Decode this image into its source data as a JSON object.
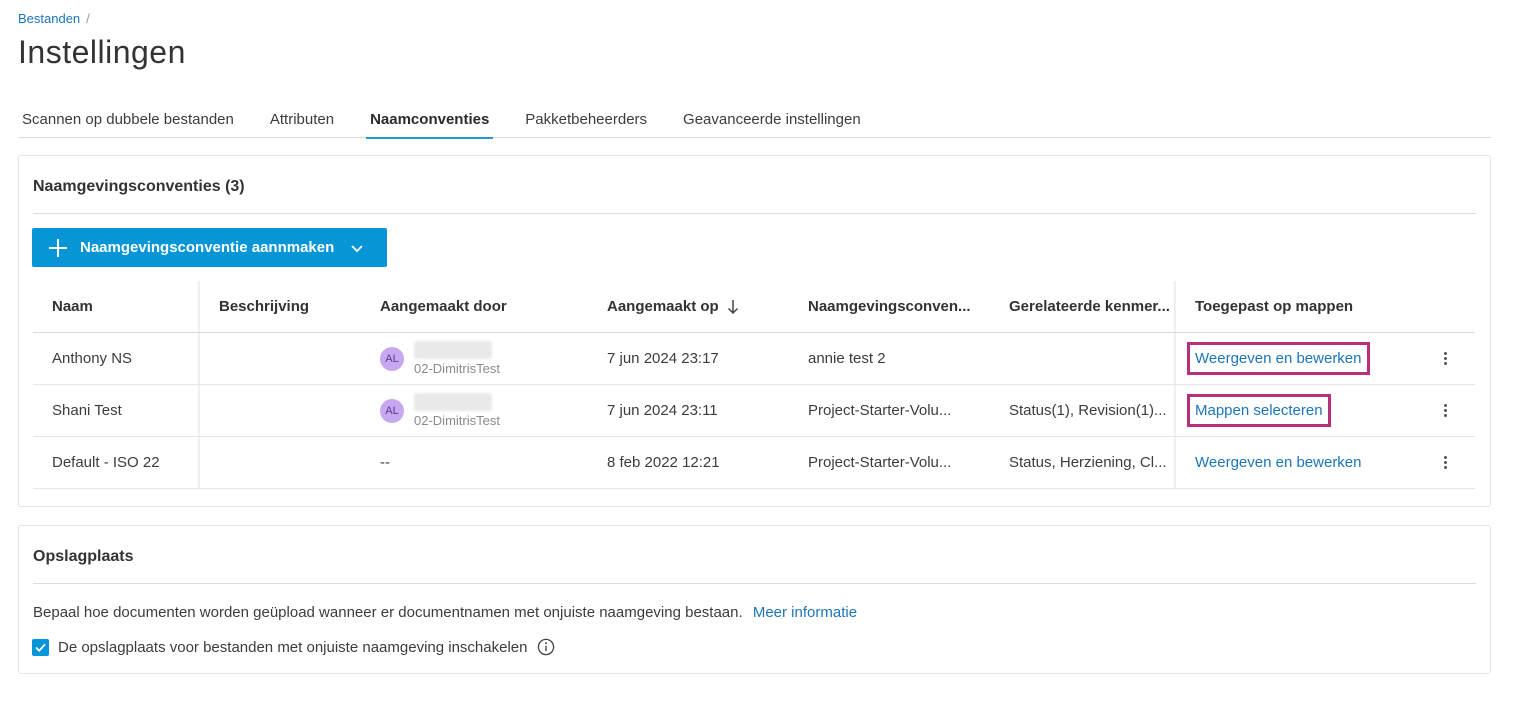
{
  "breadcrumb": {
    "parent": "Bestanden",
    "separator": "/"
  },
  "page_title": "Instellingen",
  "tabs": [
    {
      "label": "Scannen op dubbele bestanden",
      "active": false
    },
    {
      "label": "Attributen",
      "active": false
    },
    {
      "label": "Naamconventies",
      "active": true
    },
    {
      "label": "Pakketbeheerders",
      "active": false
    },
    {
      "label": "Geavanceerde instellingen",
      "active": false
    }
  ],
  "conventions_card": {
    "title": "Naamgevingsconventies (3)",
    "create_button_label": "Naamgevingsconventie aannmaken",
    "columns": {
      "name": "Naam",
      "description": "Beschrijving",
      "created_by": "Aangemaakt door",
      "created_on": "Aangemaakt op",
      "convention": "Naamgevingsconven...",
      "related": "Gerelateerde kenmer...",
      "applied": "Toegepast op mappen"
    },
    "rows": [
      {
        "name": "Anthony NS",
        "description": "",
        "avatar": "AL",
        "user_sub": "02-DimitrisTest",
        "created_on": "7 jun 2024 23:17",
        "convention": "annie test 2",
        "related": "",
        "applied": "Weergeven en bewerken"
      },
      {
        "name": "Shani Test",
        "description": "",
        "avatar": "AL",
        "user_sub": "02-DimitrisTest",
        "created_on": "7 jun 2024 23:11",
        "convention": "Project-Starter-Volu...",
        "related": "Status(1), Revision(1)...",
        "applied": "Mappen selecteren"
      },
      {
        "name": "Default - ISO 22",
        "description": "",
        "created_by": "--",
        "created_on": "8 feb 2022 12:21",
        "convention": "Project-Starter-Volu...",
        "related": "Status, Herziening, Cl...",
        "applied": "Weergeven en bewerken"
      }
    ]
  },
  "storage_card": {
    "title": "Opslagplaats",
    "description": "Bepaal hoe documenten worden geüpload wanneer er documentnamen met onjuiste naamgeving bestaan.",
    "more_info": "Meer informatie",
    "checkbox_label": "De opslagplaats voor bestanden met onjuiste naamgeving inschakelen",
    "checkbox_checked": true
  },
  "colors": {
    "accent": "#0696d7",
    "link": "#1c75b8",
    "highlight": "#b8307a",
    "avatar": "#c7a8f0"
  },
  "icons": {
    "create": "plus-icon",
    "dropdown": "chevron-down-icon",
    "sort": "arrow-down-icon",
    "more": "kebab-icon",
    "info": "info-icon",
    "check": "check-icon"
  }
}
